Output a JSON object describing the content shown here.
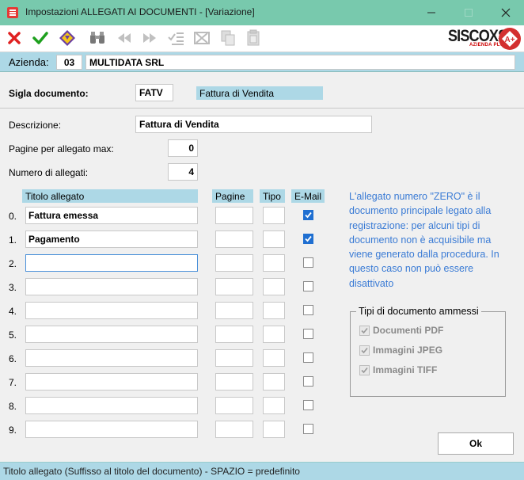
{
  "window": {
    "title": "Impostazioni ALLEGATI AI DOCUMENTI - [Variazione]",
    "controls": [
      "minimize",
      "maximize",
      "close"
    ]
  },
  "toolbar": {
    "buttons": [
      "cancel-icon",
      "confirm-icon",
      "filter-icon",
      "binoculars-icon",
      "first-icon",
      "last-icon",
      "check-list-icon",
      "delete-icon",
      "copy-icon",
      "paste-icon"
    ],
    "brand": "SISCOXS",
    "brand_sub": "AZIENDA PLUS",
    "brand_badge": "A+"
  },
  "azienda": {
    "label": "Azienda:",
    "code": "03",
    "name": "MULTIDATA SRL"
  },
  "form": {
    "sigla_label": "Sigla documento:",
    "sigla_value": "FATV",
    "sigla_desc": "Fattura di Vendita",
    "descrizione_label": "Descrizione:",
    "descrizione_value": "Fattura di Vendita",
    "pagine_label": "Pagine per allegato max:",
    "pagine_value": "0",
    "numero_label": "Numero di allegati:",
    "numero_value": "4"
  },
  "table": {
    "headers": {
      "titolo": "Titolo allegato",
      "pagine": "Pagine",
      "tipo": "Tipo",
      "email": "E-Mail"
    },
    "rows": [
      {
        "num": "0.",
        "titolo": "Fattura emessa",
        "pagine": "",
        "tipo": "",
        "email": true
      },
      {
        "num": "1.",
        "titolo": "Pagamento",
        "pagine": "",
        "tipo": "",
        "email": true
      },
      {
        "num": "2.",
        "titolo": "",
        "pagine": "",
        "tipo": "",
        "email": false
      },
      {
        "num": "3.",
        "titolo": "",
        "pagine": "",
        "tipo": "",
        "email": false
      },
      {
        "num": "4.",
        "titolo": "",
        "pagine": "",
        "tipo": "",
        "email": false
      },
      {
        "num": "5.",
        "titolo": "",
        "pagine": "",
        "tipo": "",
        "email": false
      },
      {
        "num": "6.",
        "titolo": "",
        "pagine": "",
        "tipo": "",
        "email": false
      },
      {
        "num": "7.",
        "titolo": "",
        "pagine": "",
        "tipo": "",
        "email": false
      },
      {
        "num": "8.",
        "titolo": "",
        "pagine": "",
        "tipo": "",
        "email": false
      },
      {
        "num": "9.",
        "titolo": "",
        "pagine": "",
        "tipo": "",
        "email": false
      }
    ]
  },
  "info_text": "L'allegato numero \"ZERO\" è il documento principale legato alla registrazione: per alcuni tipi di documento non è acquisibile ma viene generato dalla procedura. In questo caso non può essere disattivato",
  "tipi": {
    "title": "Tipi di documento ammessi",
    "items": [
      {
        "label": "Documenti PDF",
        "checked": true
      },
      {
        "label": "Immagini JPEG",
        "checked": true
      },
      {
        "label": "Immagini TIFF",
        "checked": true
      }
    ]
  },
  "ok_label": "Ok",
  "status_text": "Titolo allegato (Suffisso al titolo del documento) - SPAZIO = predefinito",
  "colors": {
    "titlebar": "#78c9ad",
    "label_bg": "#add8e6",
    "info_text": "#3a7bd5",
    "checkbox_on": "#1f6fd1"
  }
}
